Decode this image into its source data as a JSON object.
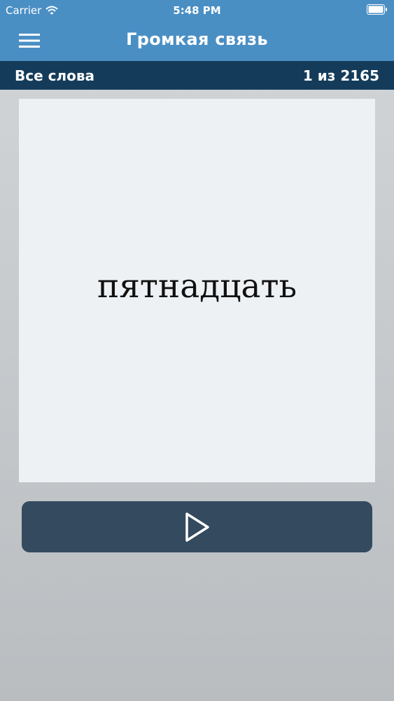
{
  "status_bar": {
    "carrier": "Carrier",
    "time": "5:48 PM"
  },
  "nav": {
    "title": "Громкая связь",
    "menu_icon": "hamburger-menu-icon"
  },
  "subbar": {
    "list_name": "Все слова",
    "position": "1 из 2165"
  },
  "card": {
    "word": "пятнадцать"
  },
  "player": {
    "icon": "play-icon"
  },
  "colors": {
    "header": "#4a8fc4",
    "subbar": "#143c5a",
    "card": "#eef1f3",
    "button": "#344a5f"
  }
}
